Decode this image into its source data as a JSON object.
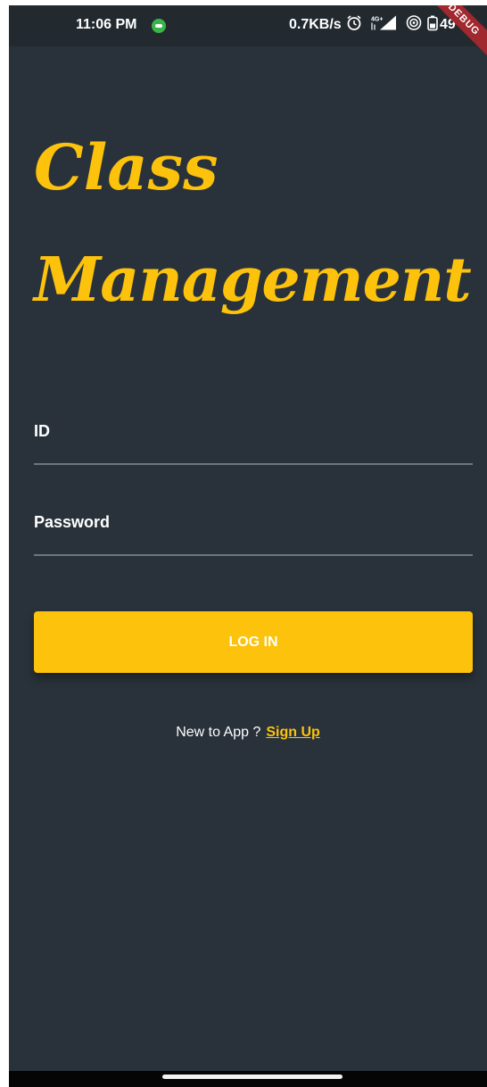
{
  "status_bar": {
    "time": "11:06 PM",
    "speed": "0.7KB/s",
    "network": "4G+",
    "battery": "49",
    "icons": [
      "chat-notification-icon",
      "alarm-icon",
      "signal-icon",
      "hotspot-icon",
      "battery-icon"
    ]
  },
  "debug_banner": "DEBUG",
  "app": {
    "title_line1": "Class",
    "title_line2": "Management"
  },
  "form": {
    "id_label": "ID",
    "password_label": "Password",
    "login_button": "LOG IN",
    "signup_prompt": "New to App ?",
    "signup_link": "Sign Up"
  },
  "colors": {
    "background": "#29323a",
    "accent": "#fdc20c",
    "status_bar": "#222a30",
    "debug_ribbon": "#a0282e"
  }
}
